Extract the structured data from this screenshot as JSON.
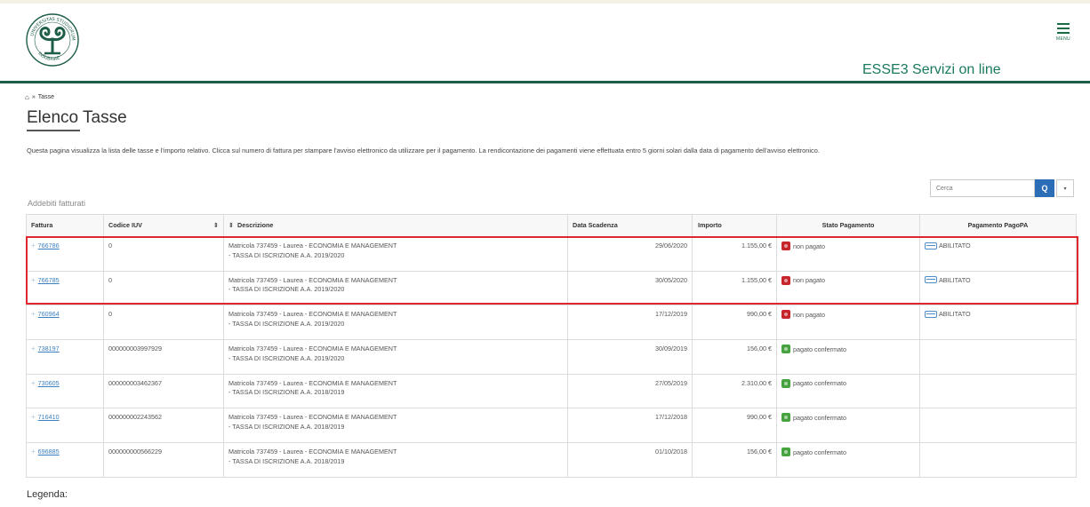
{
  "header": {
    "site_title": "ESSE3 Servizi on line",
    "menu_label": "MENU",
    "brand_color": "#1e5e46",
    "logo_lettering": "UNIVERSITAS STUDIORUM INSUBRIAE"
  },
  "breadcrumb": {
    "home_icon": "home-icon",
    "separator": "»",
    "current": "Tasse"
  },
  "page": {
    "title": "Elenco Tasse",
    "intro": "Questa pagina visualizza la lista delle tasse e l'importo relativo. Clicca sul numero di fattura per stampare l'avviso elettronico da utilizzare per il pagamento. La rendicontazione dei pagamenti viene effettuata entro 5 giorni solari dalla data di pagamento dell'avviso elettronico."
  },
  "search": {
    "placeholder": "Cerca",
    "button_icon": "search-icon",
    "button_glyph": "Q",
    "dropdown_glyph": "▾",
    "button_color": "#2b6db6"
  },
  "table": {
    "caption": "Addebiti fatturati",
    "columns": {
      "fattura": "Fattura",
      "iuv": "Codice IUV",
      "descrizione": "Descrizione",
      "data": "Data Scadenza",
      "importo": "Importo",
      "stato": "Stato Pagamento",
      "pagopa": "Pagamento PagoPA"
    },
    "sort_glyph": "⇕",
    "rows": [
      {
        "fattura": "766786",
        "iuv": "0",
        "desc1": "Matricola 737459 - Laurea - ECONOMIA E MANAGEMENT",
        "desc2": "- TASSA DI ISCRIZIONE A.A. 2019/2020",
        "data": "29/06/2020",
        "importo": "1.155,00 €",
        "stato": "non pagato",
        "stato_color": "#c5252b",
        "pagopa": "ABILITATO"
      },
      {
        "fattura": "766785",
        "iuv": "0",
        "desc1": "Matricola 737459 - Laurea - ECONOMIA E MANAGEMENT",
        "desc2": "- TASSA DI ISCRIZIONE A.A. 2019/2020",
        "data": "30/05/2020",
        "importo": "1.155,00 €",
        "stato": "non pagato",
        "stato_color": "#c5252b",
        "pagopa": "ABILITATO"
      },
      {
        "fattura": "760964",
        "iuv": "0",
        "desc1": "Matricola 737459 - Laurea - ECONOMIA E MANAGEMENT",
        "desc2": "- TASSA DI ISCRIZIONE A.A. 2019/2020",
        "data": "17/12/2019",
        "importo": "990,00 €",
        "stato": "non pagato",
        "stato_color": "#c5252b",
        "pagopa": "ABILITATO"
      },
      {
        "fattura": "738197",
        "iuv": "000000003997929",
        "desc1": "Matricola 737459 - Laurea - ECONOMIA E MANAGEMENT",
        "desc2": "- TASSA DI ISCRIZIONE A.A. 2019/2020",
        "data": "30/09/2019",
        "importo": "156,00 €",
        "stato": "pagato confermato",
        "stato_color": "#47a33f",
        "pagopa": ""
      },
      {
        "fattura": "730605",
        "iuv": "000000003462367",
        "desc1": "Matricola 737459 - Laurea - ECONOMIA E MANAGEMENT",
        "desc2": "- TASSA DI ISCRIZIONE A.A. 2018/2019",
        "data": "27/05/2019",
        "importo": "2.310,00 €",
        "stato": "pagato confermato",
        "stato_color": "#47a33f",
        "pagopa": ""
      },
      {
        "fattura": "716410",
        "iuv": "000000002243562",
        "desc1": "Matricola 737459 - Laurea - ECONOMIA E MANAGEMENT",
        "desc2": "- TASSA DI ISCRIZIONE A.A. 2018/2019",
        "data": "17/12/2018",
        "importo": "990,00 €",
        "stato": "pagato confermato",
        "stato_color": "#47a33f",
        "pagopa": ""
      },
      {
        "fattura": "696885",
        "iuv": "000000000566229",
        "desc1": "Matricola 737459 - Laurea - ECONOMIA E MANAGEMENT",
        "desc2": "- TASSA DI ISCRIZIONE A.A. 2018/2019",
        "data": "01/10/2018",
        "importo": "156,00 €",
        "stato": "pagato confermato",
        "stato_color": "#47a33f",
        "pagopa": ""
      }
    ]
  },
  "highlight_color": "#e0262e",
  "legenda": "Legenda:"
}
